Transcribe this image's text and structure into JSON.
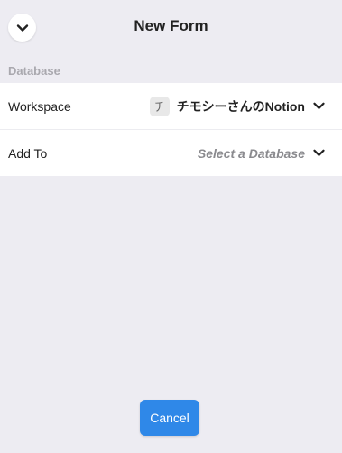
{
  "header": {
    "title": "New Form",
    "back_icon": "chevron-down-icon"
  },
  "section": {
    "label": "Database"
  },
  "rows": [
    {
      "label": "Workspace",
      "avatar_text": "チ",
      "value": "チモシーさんのNotion",
      "icon": "chevron-down-icon"
    },
    {
      "label": "Add To",
      "placeholder": "Select a Database",
      "icon": "chevron-down-icon"
    }
  ],
  "footer": {
    "cancel_label": "Cancel"
  },
  "colors": {
    "background": "#edecf2",
    "card": "#ffffff",
    "accent": "#2f88e8",
    "muted_label": "#a9a8ae",
    "placeholder": "#8a8a8e"
  }
}
